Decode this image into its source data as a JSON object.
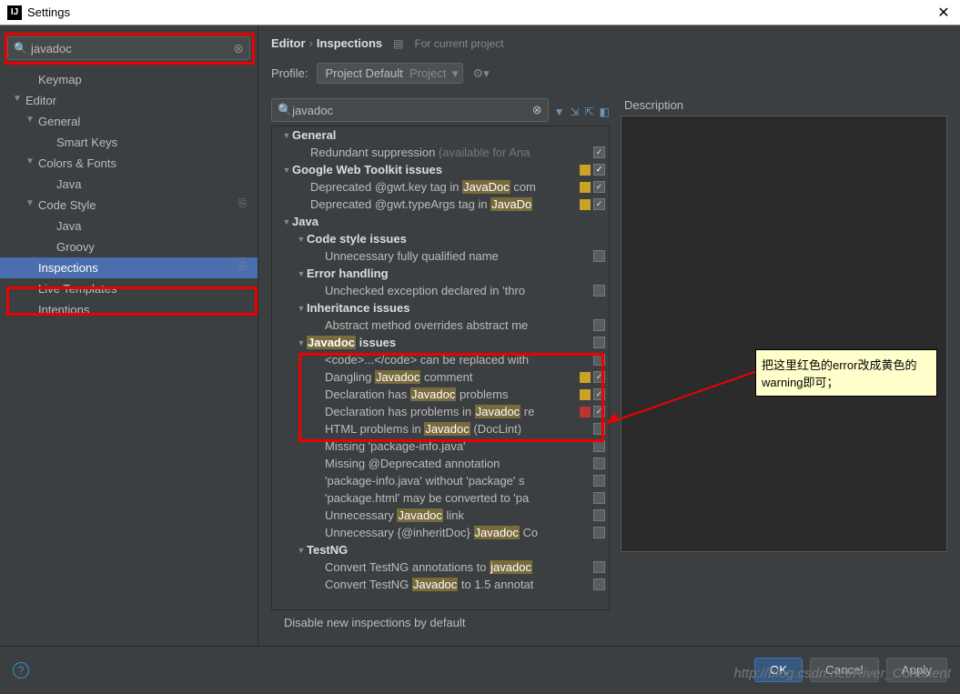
{
  "window": {
    "title": "Settings"
  },
  "sidebar": {
    "search": "javadoc",
    "items": [
      {
        "label": "Keymap",
        "depth": 1,
        "expandable": false
      },
      {
        "label": "Editor",
        "depth": 0,
        "expandable": true,
        "expanded": true
      },
      {
        "label": "General",
        "depth": 1,
        "expandable": true,
        "expanded": true
      },
      {
        "label": "Smart Keys",
        "depth": 2
      },
      {
        "label": "Colors & Fonts",
        "depth": 1,
        "expandable": true,
        "expanded": true
      },
      {
        "label": "Java",
        "depth": 2
      },
      {
        "label": "Code Style",
        "depth": 1,
        "expandable": true,
        "expanded": true,
        "icon": true
      },
      {
        "label": "Java",
        "depth": 2
      },
      {
        "label": "Groovy",
        "depth": 2
      },
      {
        "label": "Inspections",
        "depth": 1,
        "selected": true,
        "icon": true
      },
      {
        "label": "Live Templates",
        "depth": 1
      },
      {
        "label": "Intentions",
        "depth": 1
      }
    ]
  },
  "breadcrumb": {
    "path1": "Editor",
    "path2": "Inspections",
    "scope": "For current project"
  },
  "profile": {
    "label": "Profile:",
    "name": "Project Default",
    "suffix": "Project"
  },
  "insp_search": "javadoc",
  "insp_tree": [
    {
      "d": 0,
      "text": "General",
      "arrow": "▼"
    },
    {
      "d": 2,
      "pre": "Redundant suppression ",
      "grey": "(available for Ana",
      "cb": "checked"
    },
    {
      "d": 0,
      "text": "Google Web Toolkit issues",
      "arrow": "▼",
      "sev": "yellow",
      "cb": "checked"
    },
    {
      "d": 2,
      "pre": "Deprecated @gwt.key tag in ",
      "hl": "JavaDoc",
      "post": " com",
      "sev": "yellow",
      "cb": "checked"
    },
    {
      "d": 2,
      "pre": "Deprecated @gwt.typeArgs tag in ",
      "hl": "JavaDo",
      "sev": "yellow",
      "cb": "checked"
    },
    {
      "d": 0,
      "text": "Java",
      "arrow": "▼"
    },
    {
      "d": 1,
      "text": "Code style issues",
      "arrow": "▼"
    },
    {
      "d": 3,
      "pre": "Unnecessary fully qualified name",
      "cb": ""
    },
    {
      "d": 1,
      "text": "Error handling",
      "arrow": "▼"
    },
    {
      "d": 3,
      "pre": "Unchecked exception declared in 'thro",
      "cb": ""
    },
    {
      "d": 1,
      "text": "Inheritance issues",
      "arrow": "▼"
    },
    {
      "d": 3,
      "pre": "Abstract method overrides abstract me",
      "cb": ""
    },
    {
      "d": 1,
      "arrow": "▼",
      "hl": "Javadoc",
      "post": " issues",
      "cb": ""
    },
    {
      "d": 3,
      "pre": "<code>...</code> can be replaced with",
      "cb": ""
    },
    {
      "d": 3,
      "pre": "Dangling ",
      "hl": "Javadoc",
      "post": " comment",
      "sev": "yellow",
      "cb": "checked"
    },
    {
      "d": 3,
      "pre": "Declaration has ",
      "hl": "Javadoc",
      "post": " problems",
      "sev": "yellow",
      "cb": "checked"
    },
    {
      "d": 3,
      "pre": "Declaration has problems in ",
      "hl": "Javadoc",
      "post": " re",
      "sev": "red",
      "cb": "checked"
    },
    {
      "d": 3,
      "pre": "HTML problems in ",
      "hl": "Javadoc",
      "post": " (DocLint)",
      "cb": ""
    },
    {
      "d": 3,
      "pre": "Missing 'package-info.java'",
      "cb": ""
    },
    {
      "d": 3,
      "pre": "Missing @Deprecated annotation",
      "cb": ""
    },
    {
      "d": 3,
      "pre": "'package-info.java' without 'package' s",
      "cb": ""
    },
    {
      "d": 3,
      "pre": "'package.html' may be converted to 'pa",
      "cb": ""
    },
    {
      "d": 3,
      "pre": "Unnecessary ",
      "hl": "Javadoc",
      "post": " link",
      "cb": ""
    },
    {
      "d": 3,
      "pre": "Unnecessary {@inheritDoc} ",
      "hl": "Javadoc",
      "post": " Co",
      "cb": ""
    },
    {
      "d": 1,
      "text": "TestNG",
      "arrow": "▼"
    },
    {
      "d": 3,
      "pre": "Convert TestNG annotations to ",
      "hl": "javadoc",
      "cb": ""
    },
    {
      "d": 3,
      "pre": "Convert TestNG ",
      "hl": "Javadoc",
      "post": " to 1.5 annotat",
      "cb": ""
    }
  ],
  "disable_row": "Disable new inspections by default",
  "description_label": "Description",
  "annotation": "把这里红色的error改成黄色的warning即可；",
  "footer": {
    "ok": "OK",
    "cancel": "Cancel",
    "apply": "Apply"
  },
  "watermark": "http://blog.csdn.net/River_Continent"
}
